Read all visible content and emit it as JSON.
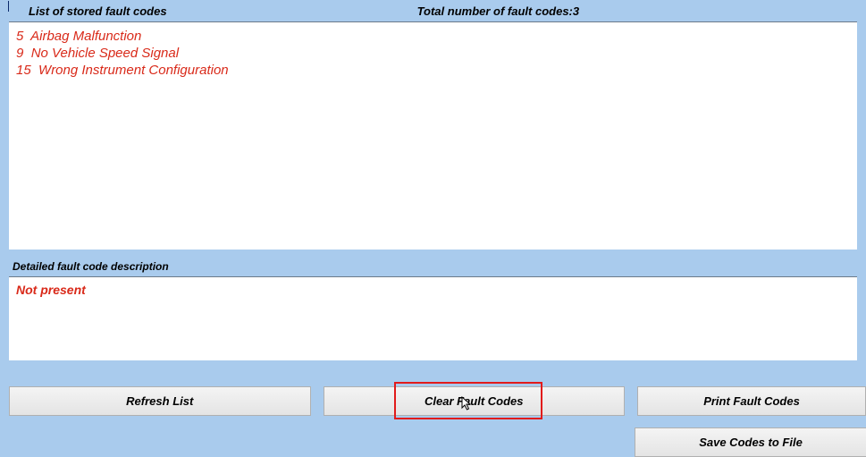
{
  "header": {
    "list_label": "List of stored fault codes",
    "total_label_prefix": "Total number of fault codes:",
    "total_count": 3
  },
  "fault_codes": [
    {
      "code": "5",
      "name": "Airbag Malfunction"
    },
    {
      "code": "9",
      "name": "No Vehicle Speed Signal"
    },
    {
      "code": "15",
      "name": "Wrong Instrument Configuration"
    }
  ],
  "description": {
    "label": "Detailed fault code description",
    "text": "Not present"
  },
  "buttons": {
    "refresh": "Refresh List",
    "clear": "Clear Fault Codes",
    "print": "Print Fault Codes",
    "save": "Save Codes to File"
  }
}
